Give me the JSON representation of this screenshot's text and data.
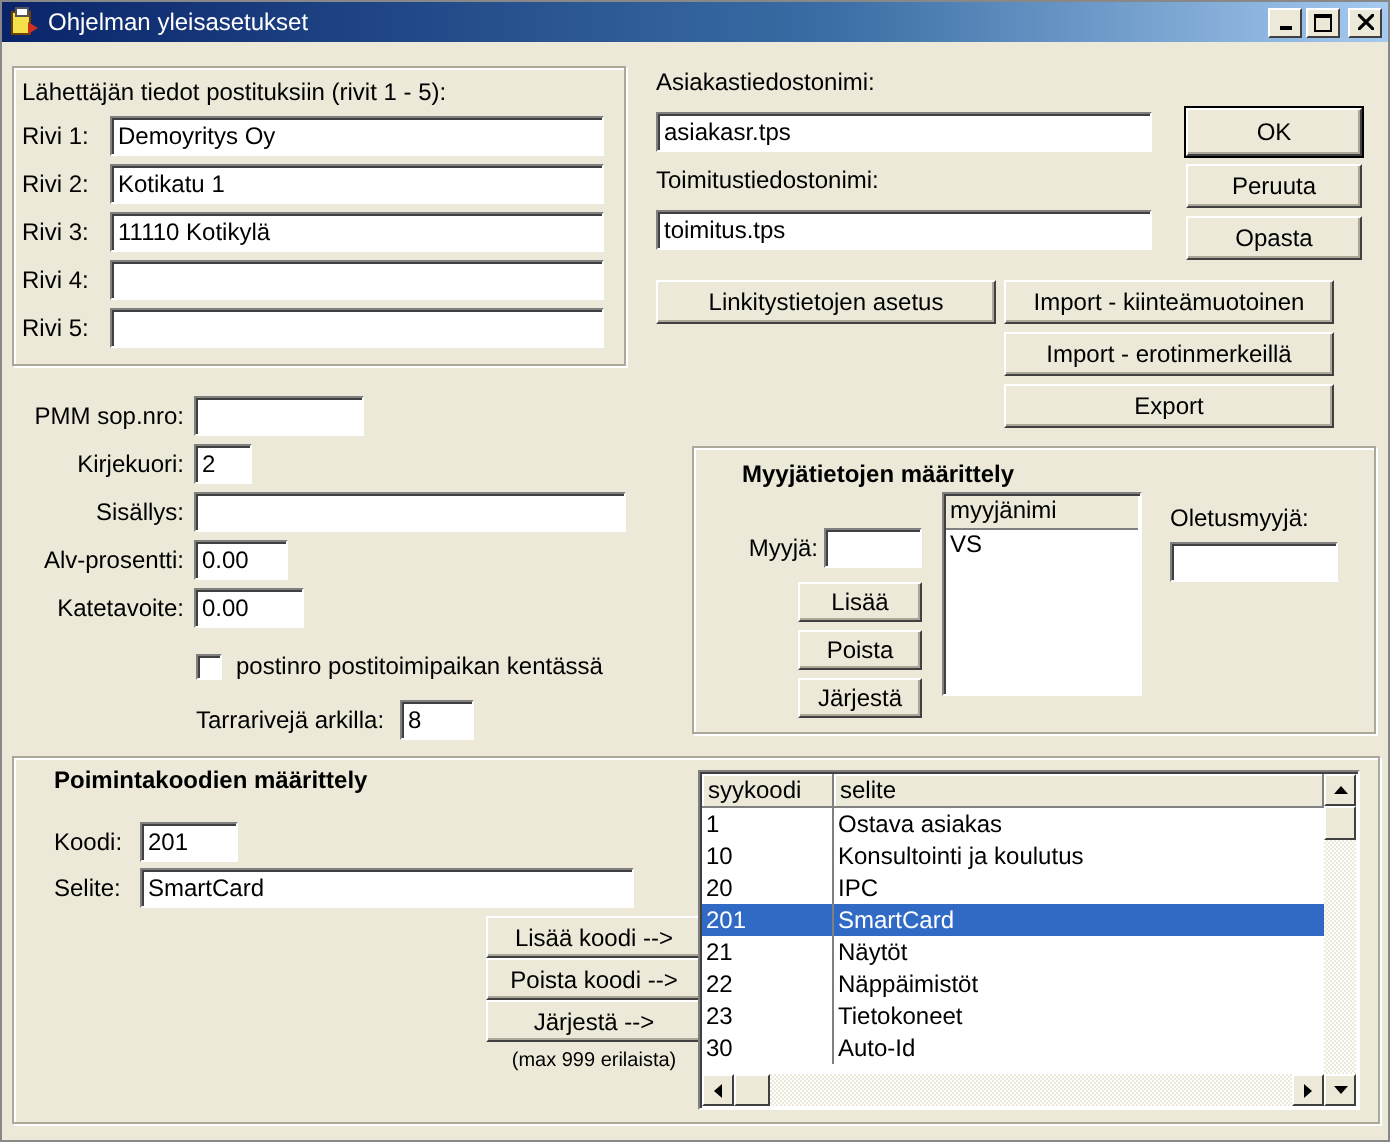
{
  "window": {
    "title": "Ohjelman yleisasetukset"
  },
  "sender": {
    "title": "Lähettäjän tiedot postituksiin (rivit 1 - 5):",
    "rows": [
      {
        "label": "Rivi 1:",
        "value": "Demoyritys Oy"
      },
      {
        "label": "Rivi 2:",
        "value": "Kotikatu 1"
      },
      {
        "label": "Rivi 3:",
        "value": "11110 Kotikylä"
      },
      {
        "label": "Rivi 4:"
      },
      {
        "label": "Rivi 5:"
      }
    ]
  },
  "files": [
    {
      "label": "Asiakastiedostonimi:",
      "value": "asiakasr.tps"
    },
    {
      "label": "Toimitustiedostonimi:",
      "value": "toimitus.tps"
    }
  ],
  "dialog_buttons": [
    {
      "label": "OK",
      "default": true
    },
    {
      "label": "Peruuta",
      "default": false
    },
    {
      "label": "Opasta",
      "default": false
    }
  ],
  "action_buttons": [
    "Linkitystietojen asetus",
    "Import - kiinteämuotoinen",
    "Import - erotinmerkeillä",
    "Export"
  ],
  "settings": [
    {
      "label": "PMM sop.nro:"
    },
    {
      "label": "Kirjekuori:",
      "value": "2"
    },
    {
      "label": "Sisällys:"
    },
    {
      "label": "Alv-prosentti:",
      "value": "0.00"
    },
    {
      "label": "Katetavoite:",
      "value": "0.00"
    }
  ],
  "postcode_option": {
    "label": "postinro postitoimipaikan kentässä",
    "checked": false
  },
  "labels_per_sheet": {
    "label": "Tarrarivejä arkilla:",
    "value": "8"
  },
  "sellers": {
    "title": "Myyjätietojen määrittely",
    "seller_label": "Myyjä:",
    "buttons": [
      "Lisää",
      "Poista",
      "Järjestä"
    ],
    "list_header": "myyjänimi",
    "list_items": [
      "VS"
    ],
    "default_label": "Oletusmyyjä:"
  },
  "codes": {
    "title": "Poimintakoodien määrittely",
    "fields": [
      {
        "label": "Koodi:",
        "value": "201"
      },
      {
        "label": "Selite:",
        "value": "SmartCard"
      }
    ],
    "buttons": [
      "Lisää koodi -->",
      "Poista koodi -->",
      "Järjestä -->"
    ],
    "note": "(max 999 erilaista)",
    "table": {
      "columns": [
        "syykoodi",
        "selite"
      ],
      "rows": [
        {
          "cells": [
            "1",
            "Ostava asiakas"
          ],
          "selected": false
        },
        {
          "cells": [
            "10",
            "Konsultointi ja koulutus"
          ],
          "selected": false
        },
        {
          "cells": [
            "20",
            "IPC"
          ],
          "selected": false
        },
        {
          "cells": [
            "201",
            "SmartCard"
          ],
          "selected": true
        },
        {
          "cells": [
            "21",
            "Näytöt"
          ],
          "selected": false
        },
        {
          "cells": [
            "22",
            "Näppäimistöt"
          ],
          "selected": false
        },
        {
          "cells": [
            "23",
            "Tietokoneet"
          ],
          "selected": false
        },
        {
          "cells": [
            "30",
            "Auto-Id"
          ],
          "selected": false
        }
      ]
    }
  }
}
